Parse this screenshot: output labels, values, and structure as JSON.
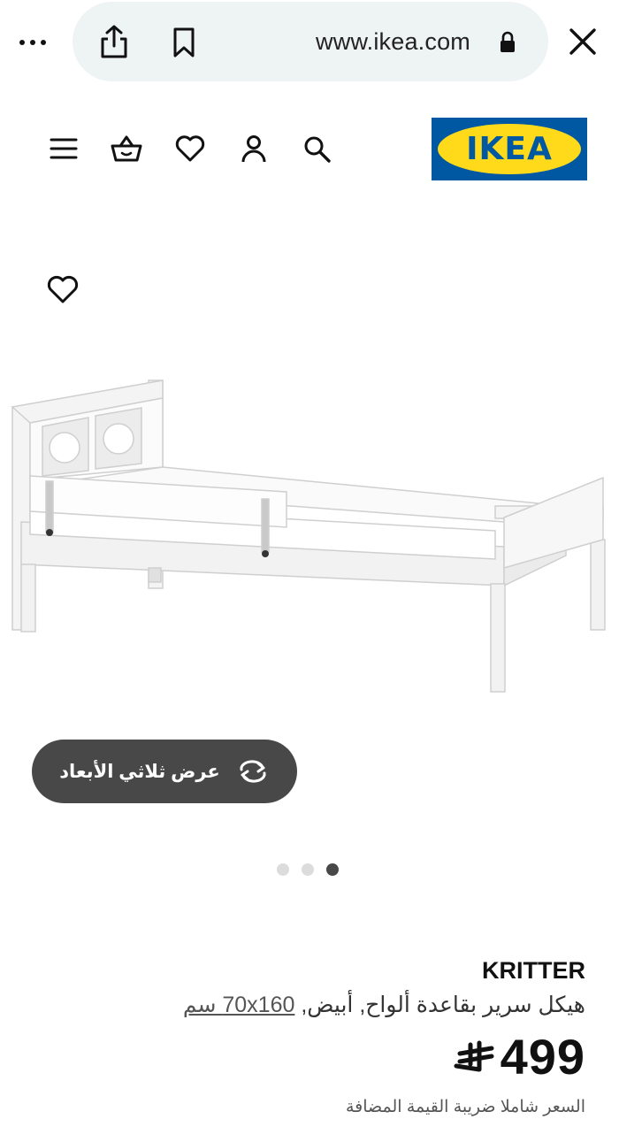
{
  "browser": {
    "url": "www.ikea.com",
    "menu_icon": "more-dots-icon",
    "share_icon": "share-icon",
    "bookmark_icon": "bookmark-icon",
    "lock_icon": "lock-icon",
    "close_icon": "close-icon"
  },
  "header": {
    "logo_text": "IKEA",
    "icons": [
      "menu-icon",
      "basket-icon",
      "heart-icon",
      "user-icon",
      "search-icon"
    ],
    "brand_colors": {
      "blue": "#0058a3",
      "yellow": "#ffda1a"
    }
  },
  "product": {
    "image_icon": "bed-illustration",
    "view_3d_label": "عرض ثلاثي الأبعاد",
    "carousel": {
      "count": 3,
      "active_index": 2
    },
    "name": "KRITTER",
    "description_main": "هيكل سرير بقاعدة ألواح, أبيض,",
    "description_dims": "70x160 سم",
    "price": "499",
    "currency": "﷼",
    "vat_note": "السعر شاملا ضريبة القيمة المضافة"
  }
}
